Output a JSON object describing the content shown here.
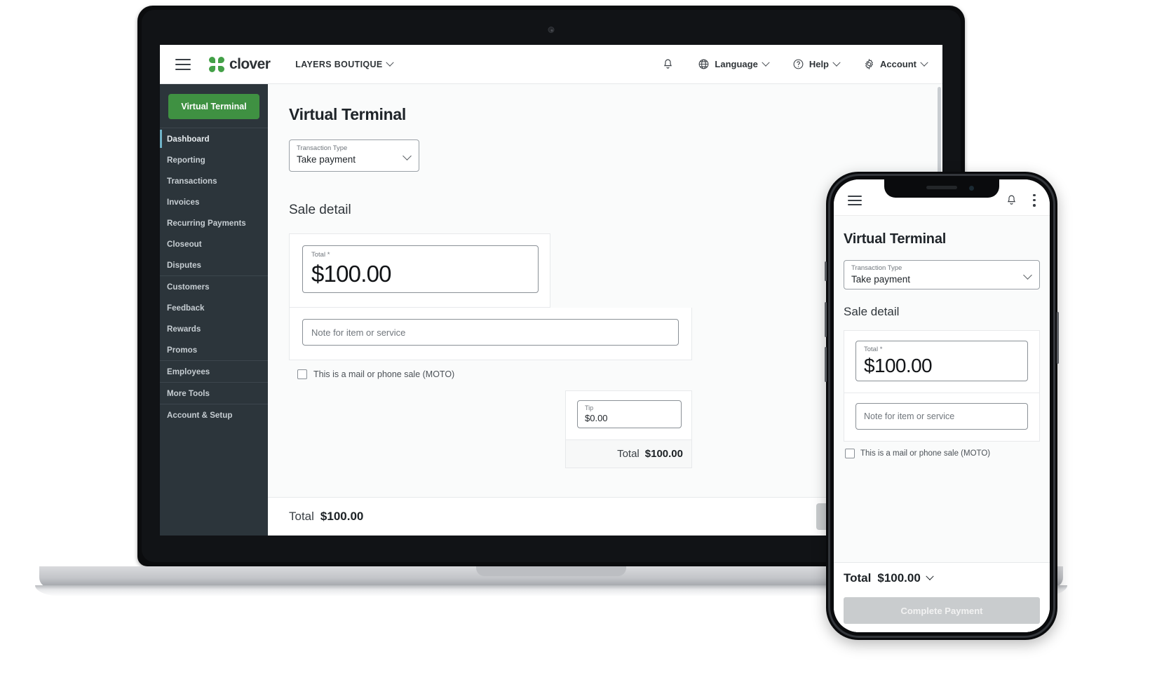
{
  "desktop": {
    "header": {
      "menu_icon": "hamburger-icon",
      "brand": "clover",
      "merchant": "LAYERS BOUTIQUE",
      "notifications_icon": "bell-icon",
      "items": [
        {
          "label": "Language",
          "icon": "globe-icon"
        },
        {
          "label": "Help",
          "icon": "question-circle-icon"
        },
        {
          "label": "Account",
          "icon": "gear-icon"
        }
      ]
    },
    "sidebar": {
      "primary_button": "Virtual Terminal",
      "groups": [
        {
          "items": [
            {
              "label": "Dashboard",
              "active": true
            },
            {
              "label": "Reporting",
              "active": false
            },
            {
              "label": "Transactions",
              "active": false
            },
            {
              "label": "Invoices",
              "active": false
            },
            {
              "label": "Recurring Payments",
              "active": false
            },
            {
              "label": "Closeout",
              "active": false
            },
            {
              "label": "Disputes",
              "active": false
            }
          ]
        },
        {
          "items": [
            {
              "label": "Customers",
              "active": false
            },
            {
              "label": "Feedback",
              "active": false
            },
            {
              "label": "Rewards",
              "active": false
            },
            {
              "label": "Promos",
              "active": false
            }
          ]
        },
        {
          "items": [
            {
              "label": "Employees",
              "active": false
            }
          ]
        },
        {
          "items": [
            {
              "label": "More Tools",
              "active": false
            }
          ]
        },
        {
          "items": [
            {
              "label": "Account & Setup",
              "active": false
            }
          ]
        }
      ]
    },
    "main": {
      "page_title": "Virtual Terminal",
      "transaction_type": {
        "label": "Transaction Type",
        "value": "Take payment"
      },
      "section_title": "Sale detail",
      "total_field": {
        "label": "Total *",
        "value": "$100.00"
      },
      "note_placeholder": "Note for item or service",
      "moto_label": "This is a mail or phone sale (MOTO)",
      "tip_field": {
        "label": "Tip",
        "value": "$0.00"
      },
      "tip_total": {
        "label": "Total",
        "value": "$100.00"
      }
    },
    "bottom_bar": {
      "total_label": "Total",
      "total_value": "$100.00",
      "submit_label": ""
    }
  },
  "phone": {
    "header": {
      "menu_icon": "hamburger-icon",
      "notifications_icon": "bell-icon",
      "overflow_icon": "kebab-menu-icon"
    },
    "main": {
      "page_title": "Virtual Terminal",
      "transaction_type": {
        "label": "Transaction Type",
        "value": "Take payment"
      },
      "section_title": "Sale detail",
      "total_field": {
        "label": "Total *",
        "value": "$100.00"
      },
      "note_placeholder": "Note for item or service",
      "moto_label": "This is a mail or phone sale (MOTO)"
    },
    "footer": {
      "total_label": "Total",
      "total_value": "$100.00",
      "cta_label": "Complete Payment"
    }
  },
  "colors": {
    "brand_green": "#3f9142",
    "sidebar_bg": "#2c353b",
    "active_accent": "#6fb3c7",
    "disabled_button": "#c9ccce"
  }
}
